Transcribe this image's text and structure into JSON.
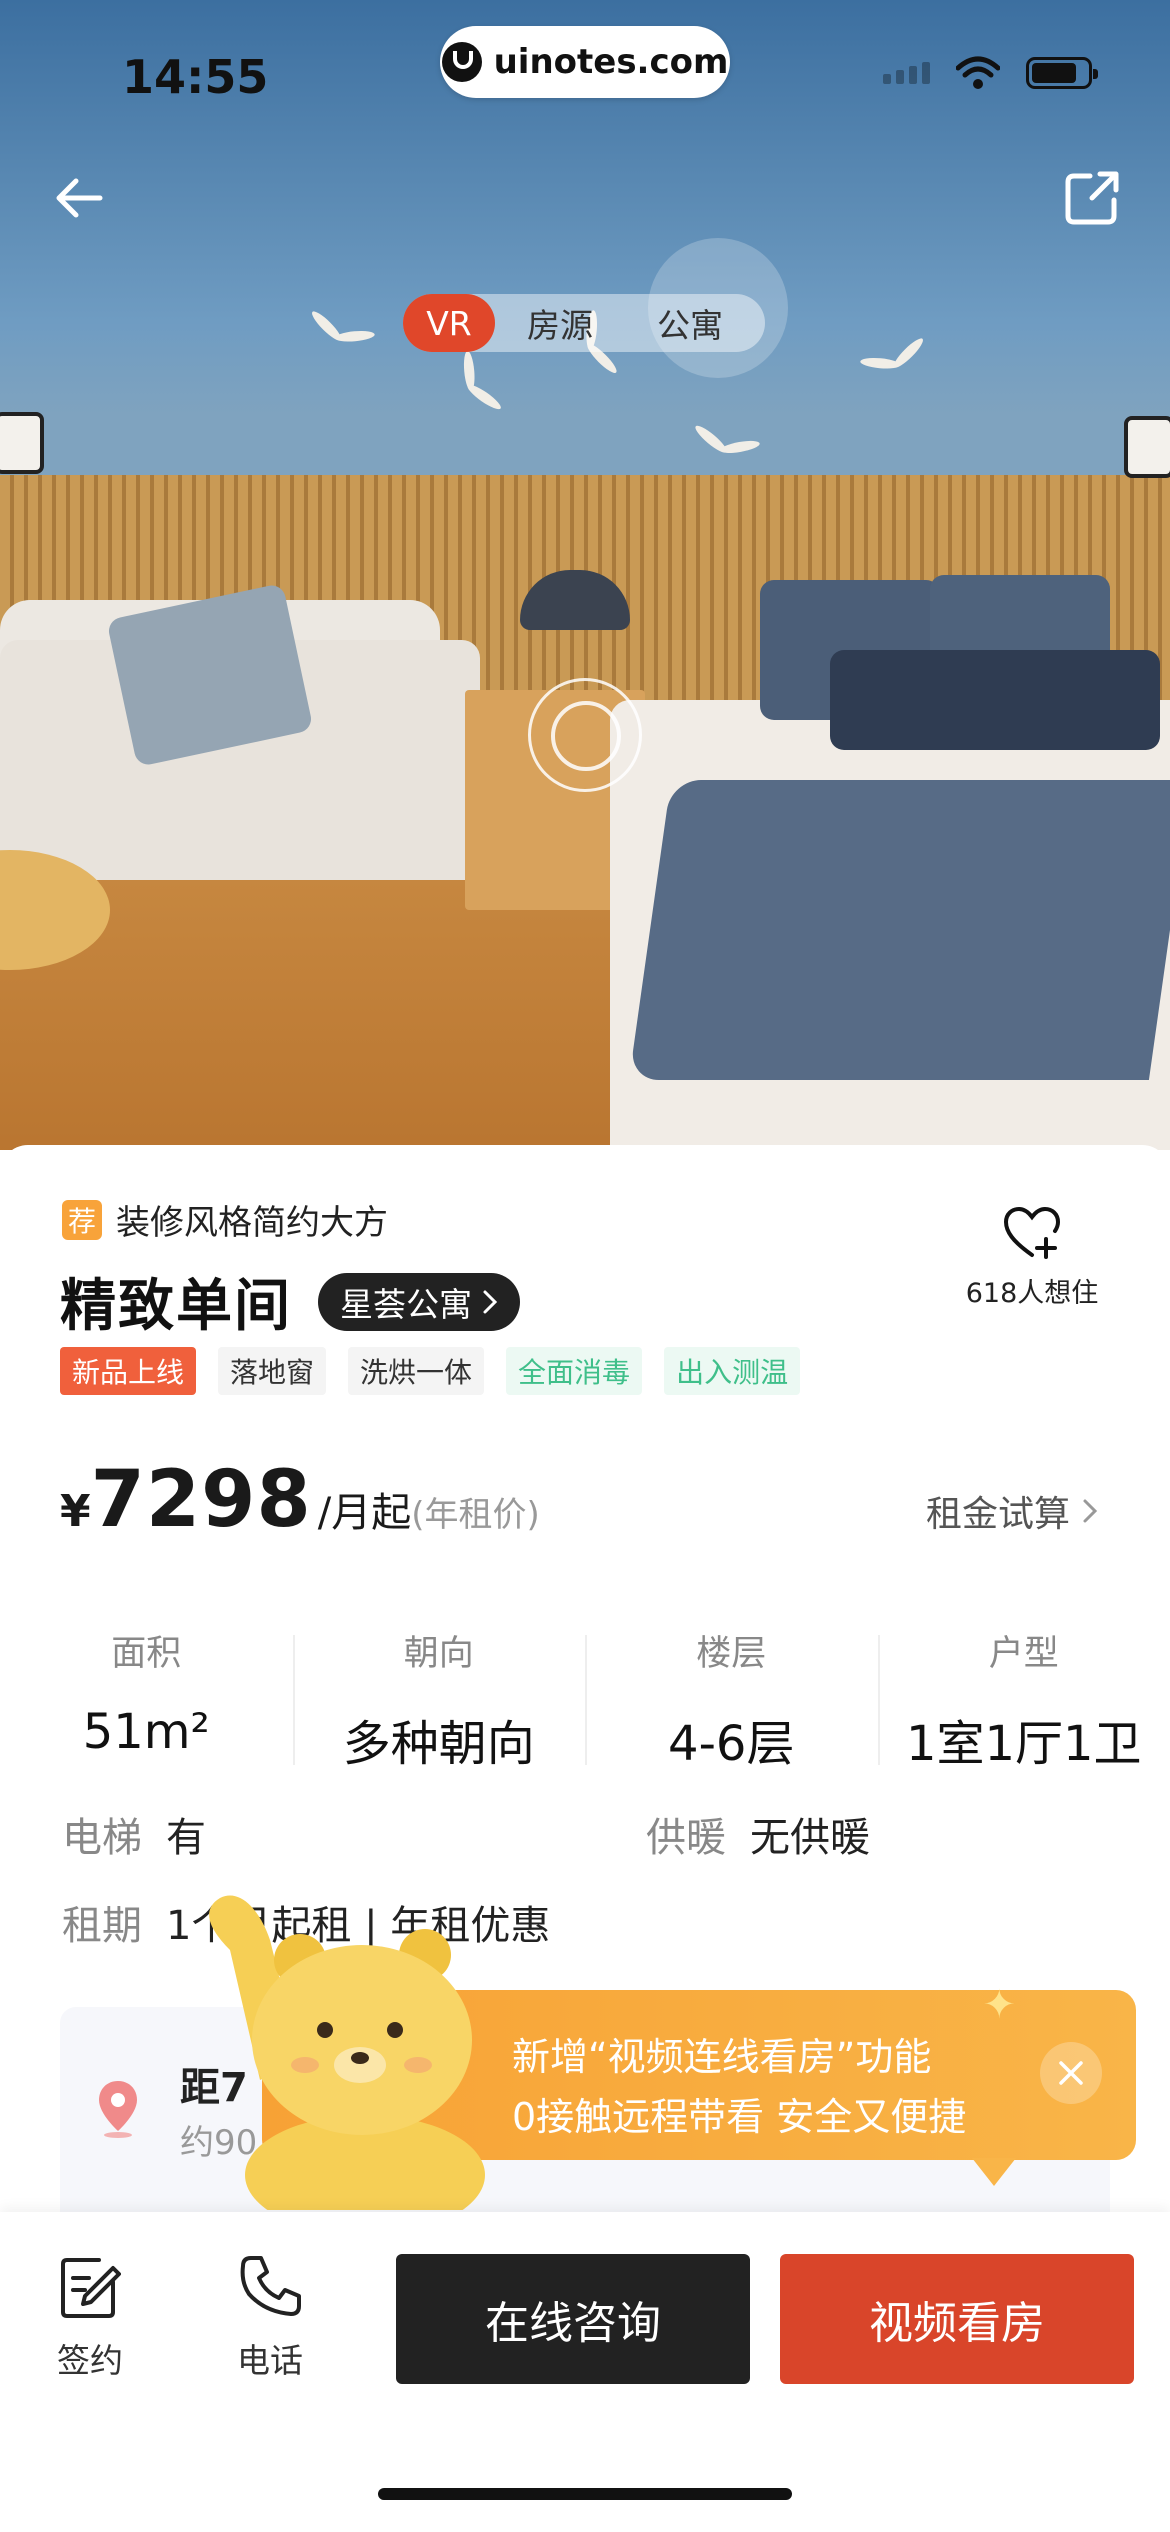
{
  "status_bar": {
    "time": "14:55"
  },
  "watermark": {
    "text": "uinotes.com"
  },
  "nav": {
    "back_icon": "arrow-left-icon",
    "share_icon": "share-icon"
  },
  "media_tabs": [
    "VR",
    "房源",
    "公寓"
  ],
  "listing": {
    "recommend_badge": "荐",
    "recommend_text": "装修风格简约大方",
    "title": "精致单间",
    "brand": "星荟公寓",
    "favorite_count_text": "618人想住",
    "tags": [
      "新品上线",
      "落地窗",
      "洗烘一体",
      "全面消毒",
      "出入测温"
    ],
    "price": {
      "currency": "¥",
      "amount": "7298",
      "unit": "/月起",
      "note": "(年租价)"
    },
    "rent_calc": "租金试算",
    "specs": [
      {
        "label": "面积",
        "value": "51m²"
      },
      {
        "label": "朝向",
        "value": "多种朝向"
      },
      {
        "label": "楼层",
        "value": "4-6层"
      },
      {
        "label": "户型",
        "value": "1室1厅1卫"
      }
    ],
    "elevator": {
      "label": "电梯",
      "value": "有"
    },
    "heating": {
      "label": "供暖",
      "value": "无供暖"
    },
    "lease": {
      "label": "租期",
      "value": "1个月起租 | 年租优惠"
    },
    "location": {
      "title": "距7",
      "subtitle": "约90"
    }
  },
  "promo": {
    "line1": "新增“视频连线看房”功能",
    "line2": "0接触远程带看 安全又便捷"
  },
  "bottom_bar": {
    "sign_label": "签约",
    "phone_label": "电话",
    "consult_button": "在线咨询",
    "video_button": "视频看房"
  },
  "colors": {
    "accent": "#d9452a",
    "promo": "#f7a235",
    "dark": "#222222"
  }
}
